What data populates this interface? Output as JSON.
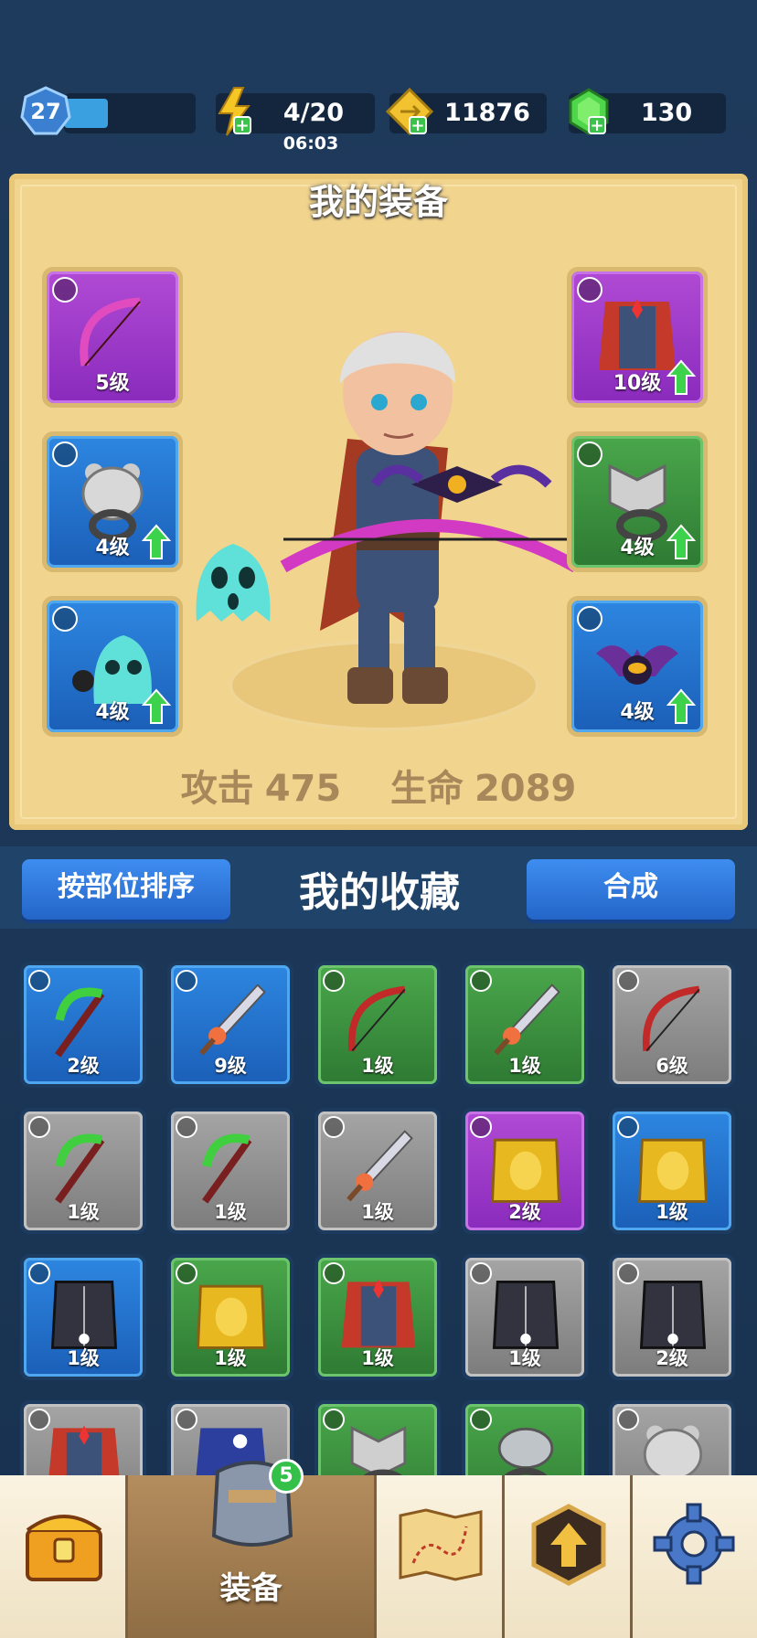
{
  "topbar": {
    "level": "27",
    "xp_fraction": 0.33,
    "energy": "4/20",
    "energy_timer": "06:03",
    "gold": "11876",
    "gems": "130"
  },
  "equipment": {
    "title": "我的装备",
    "slots": [
      {
        "level": "5级",
        "rarity": "purple",
        "icon": "bow-icon",
        "upgrade": false
      },
      {
        "level": "4级",
        "rarity": "blue",
        "icon": "bear-ring-icon",
        "upgrade": true
      },
      {
        "level": "4级",
        "rarity": "blue",
        "icon": "ghost-pet-icon",
        "upgrade": true
      },
      {
        "level": "10级",
        "rarity": "purple",
        "icon": "cloak-armor-icon",
        "upgrade": true
      },
      {
        "level": "4级",
        "rarity": "green",
        "icon": "wolf-ring-icon",
        "upgrade": true
      },
      {
        "level": "4级",
        "rarity": "blue",
        "icon": "bat-pet-icon",
        "upgrade": true
      }
    ],
    "attack_label": "攻击",
    "attack_value": "475",
    "hp_label": "生命",
    "hp_value": "2089"
  },
  "collection": {
    "sort_button": "按部位排序",
    "title": "我的收藏",
    "merge_button": "合成",
    "items": [
      {
        "level": "2级",
        "rarity": "blue",
        "icon": "scythe-icon"
      },
      {
        "level": "9级",
        "rarity": "blue",
        "icon": "sword-icon"
      },
      {
        "level": "1级",
        "rarity": "green",
        "icon": "bow-icon"
      },
      {
        "level": "1级",
        "rarity": "green",
        "icon": "sword-icon"
      },
      {
        "level": "6级",
        "rarity": "gray",
        "icon": "bow-icon"
      },
      {
        "level": "1级",
        "rarity": "gray",
        "icon": "scythe-icon"
      },
      {
        "level": "1级",
        "rarity": "gray",
        "icon": "scythe-icon"
      },
      {
        "level": "1级",
        "rarity": "gray",
        "icon": "sword-icon"
      },
      {
        "level": "2级",
        "rarity": "purple",
        "icon": "gold-armor-icon"
      },
      {
        "level": "1级",
        "rarity": "blue",
        "icon": "gold-armor-icon"
      },
      {
        "level": "1级",
        "rarity": "blue",
        "icon": "dark-vest-icon"
      },
      {
        "level": "1级",
        "rarity": "green",
        "icon": "gold-armor-icon"
      },
      {
        "level": "1级",
        "rarity": "green",
        "icon": "cloak-armor-icon"
      },
      {
        "level": "1级",
        "rarity": "gray",
        "icon": "dark-vest-icon"
      },
      {
        "level": "2级",
        "rarity": "gray",
        "icon": "dark-vest-icon"
      },
      {
        "level": "",
        "rarity": "gray",
        "icon": "cloak-armor-icon"
      },
      {
        "level": "",
        "rarity": "gray",
        "icon": "mage-robe-icon"
      },
      {
        "level": "",
        "rarity": "green",
        "icon": "wolf-ring-icon"
      },
      {
        "level": "",
        "rarity": "green",
        "icon": "snake-ring-icon"
      },
      {
        "level": "",
        "rarity": "gray",
        "icon": "bear-ring-icon"
      }
    ]
  },
  "nav": {
    "items": [
      {
        "icon": "treasure-chest-icon",
        "label": ""
      },
      {
        "icon": "armor-icon",
        "label": "装备",
        "badge": "5"
      },
      {
        "icon": "map-icon",
        "label": ""
      },
      {
        "icon": "upgrade-icon",
        "label": ""
      },
      {
        "icon": "settings-gear-icon",
        "label": ""
      }
    ]
  }
}
